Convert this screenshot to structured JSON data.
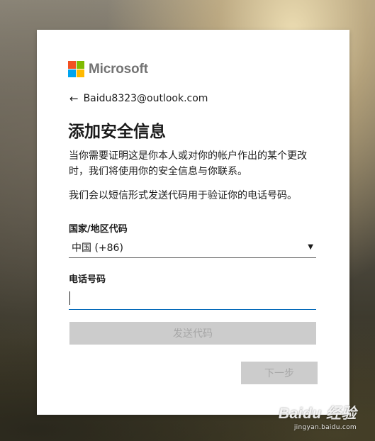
{
  "brand": {
    "name": "Microsoft",
    "colors": {
      "red": "#f25022",
      "green": "#7fba00",
      "blue": "#00a4ef",
      "yellow": "#ffb900"
    }
  },
  "account": {
    "back_icon": "back-arrow-icon",
    "email": "Baidu8323@outlook.com"
  },
  "page": {
    "title": "添加安全信息",
    "description": "当你需要证明这是你本人或对你的帐户作出的某个更改时，我们将使用你的安全信息与你联系。",
    "sms_note": "我们会以短信形式发送代码用于验证你的电话号码。"
  },
  "form": {
    "country_label": "国家/地区代码",
    "country_value": "中国 (+86)",
    "phone_label": "电话号码",
    "phone_value": "",
    "send_code_label": "发送代码",
    "next_label": "下一步"
  },
  "watermark": {
    "logo": "Baidu 经验",
    "url": "jingyan.baidu.com"
  }
}
